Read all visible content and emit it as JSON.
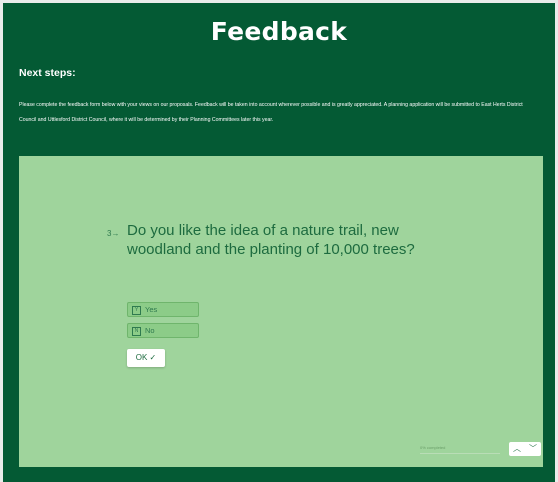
{
  "page": {
    "title": "Feedback",
    "next_steps_heading": "Next steps:",
    "intro_text": "Please complete the feedback form below with your views on our proposals. Feedback will be taken into account wherever possible and is greatly appreciated. A planning application will be submitted to East Herts District Council and Uttlesford District Council, where it will be determined by their Planning Committees later this year."
  },
  "form": {
    "question_number": "3",
    "question_arrow": "→",
    "question_text": "Do you like the idea of a nature trail, new woodland and the planting of 10,000 trees?",
    "choices": [
      {
        "key": "Y",
        "label": "Yes"
      },
      {
        "key": "N",
        "label": "No"
      }
    ],
    "ok_label": "OK ✓",
    "progress_label": "0% completed",
    "progress_fraction": 0,
    "nav_up": "︿",
    "nav_down": "﹀"
  },
  "colors": {
    "panel_bg": "#045a34",
    "form_bg": "#9fd49c",
    "text_green": "#1d6b3f"
  }
}
